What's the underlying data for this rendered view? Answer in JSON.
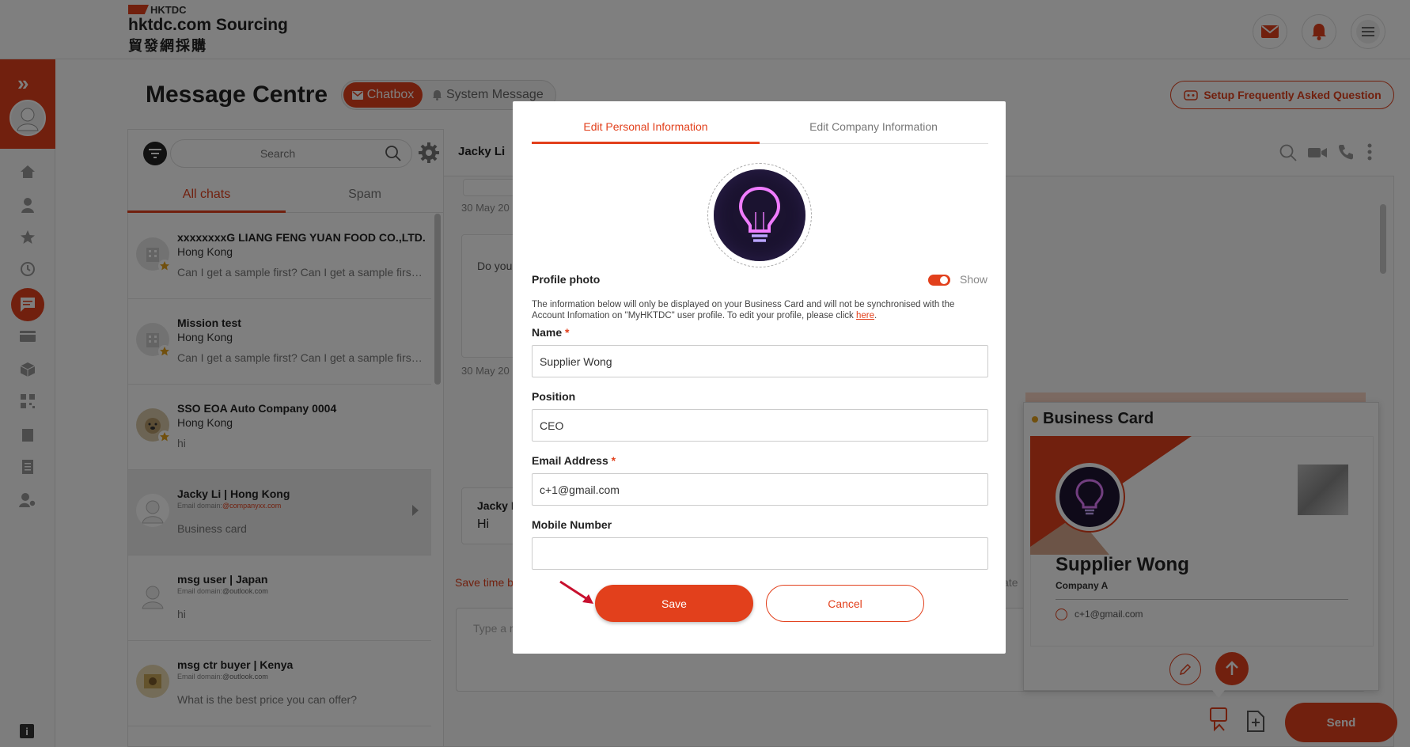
{
  "brand": {
    "hktdc": "HKTDC",
    "logo_en": "hktdc.com Sourcing",
    "logo_zh": "貿發網採購",
    "accent_color": "#e2401c"
  },
  "header": {
    "icons": [
      "mail-icon",
      "bell-icon",
      "menu-icon"
    ]
  },
  "sidebar": {
    "icons": [
      "home-icon",
      "user-icon",
      "star-icon",
      "history-icon",
      "chat-icon",
      "card-icon",
      "cube-icon",
      "qr-icon",
      "building-icon",
      "document-icon",
      "user-settings-icon"
    ],
    "info": "i"
  },
  "page": {
    "title": "Message Centre",
    "tab_chatbox": "Chatbox",
    "tab_system": "System Message",
    "faq_button": "Setup Frequently Asked Question"
  },
  "chat_list": {
    "search_placeholder": "Search",
    "tab_all": "All chats",
    "tab_spam": "Spam",
    "items": [
      {
        "name": "xxxxxxxxG LIANG FENG YUAN FOOD CO.,LTD.",
        "sub": "Hong Kong",
        "preview": "Can I get a sample first? Can I get a sample first? Can I get a sample first?"
      },
      {
        "name": "Mission test",
        "sub": "Hong Kong",
        "preview": "Can I get a sample first? Can I get a sample first? Can I get a sample first?"
      },
      {
        "name": "SSO EOA Auto Company 0004",
        "sub": "Hong Kong",
        "preview": "hi"
      },
      {
        "name": "Jacky Li |  Hong Kong",
        "domain_label": "Email domain:",
        "domain": "@companyxx.com",
        "preview": "Business card"
      },
      {
        "name": "msg user |  Japan",
        "domain_label": "Email domain:",
        "domain": "@outlook.com",
        "preview": "hi"
      },
      {
        "name": "msg ctr buyer |  Kenya",
        "domain_label": "Email domain:",
        "domain": "@outlook.com",
        "preview": "What is the best price you can offer?"
      }
    ]
  },
  "conversation": {
    "contact": "Jacky Li",
    "date1": "30 May 20",
    "bubble1": "Do you",
    "date2": "30 May 20",
    "sender": "Jacky L",
    "bubble2": "Hi",
    "save_time": "Save time b",
    "date_fragment": "late",
    "type_placeholder": "Type a r",
    "send": "Send"
  },
  "business_card": {
    "title": "Business Card",
    "name": "Supplier Wong",
    "company": "Company A",
    "email": "c+1@gmail.com"
  },
  "modal": {
    "tab_personal": "Edit Personal Information",
    "tab_company": "Edit Company Information",
    "photo_label": "Profile photo",
    "photo_toggle": "Show",
    "info_text": "The information below will only be displayed on your Business Card and will not be synchronised with the Account Infomation on \"MyHKTDC\" user profile. To edit your profile, please click ",
    "info_link": "here",
    "info_end": ".",
    "name_label": "Name",
    "name_value": "Supplier Wong",
    "position_label": "Position",
    "position_value": "CEO",
    "email_label": "Email Address",
    "email_value": "c+1@gmail.com",
    "mobile_label": "Mobile Number",
    "mobile_value": "",
    "required_mark": "*",
    "save": "Save",
    "cancel": "Cancel"
  }
}
